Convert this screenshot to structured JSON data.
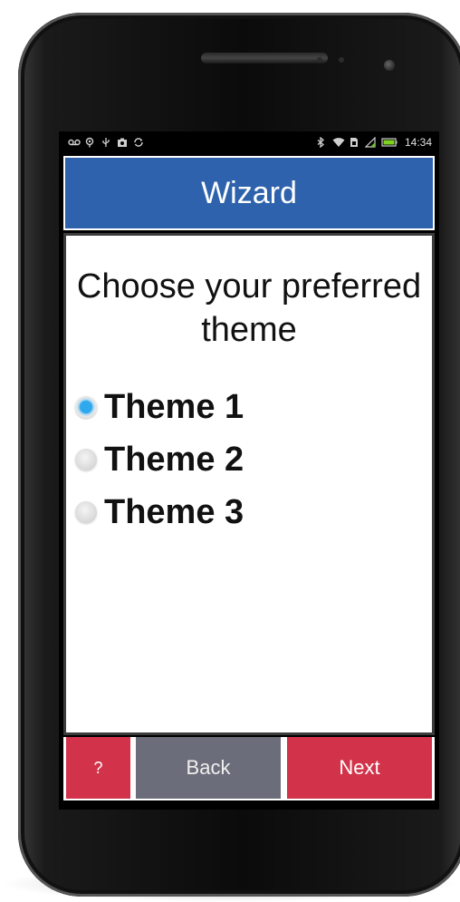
{
  "status_bar": {
    "left_icons": [
      "voicemail-icon",
      "location-icon",
      "usb-icon",
      "camera-icon",
      "sync-icon"
    ],
    "right_icons": [
      "bluetooth-icon",
      "wifi-icon",
      "sim-icon",
      "signal-icon",
      "battery-icon"
    ],
    "time": "14:34"
  },
  "header": {
    "title": "Wizard",
    "color": "#2e62ad"
  },
  "prompt": "Choose your preferred theme",
  "options": [
    {
      "label": "Theme 1",
      "selected": true
    },
    {
      "label": "Theme 2",
      "selected": false
    },
    {
      "label": "Theme 3",
      "selected": false
    }
  ],
  "footer": {
    "help_label": "?",
    "back_label": "Back",
    "next_label": "Next",
    "accent_color": "#d2334a",
    "secondary_color": "#6b6e7a"
  }
}
